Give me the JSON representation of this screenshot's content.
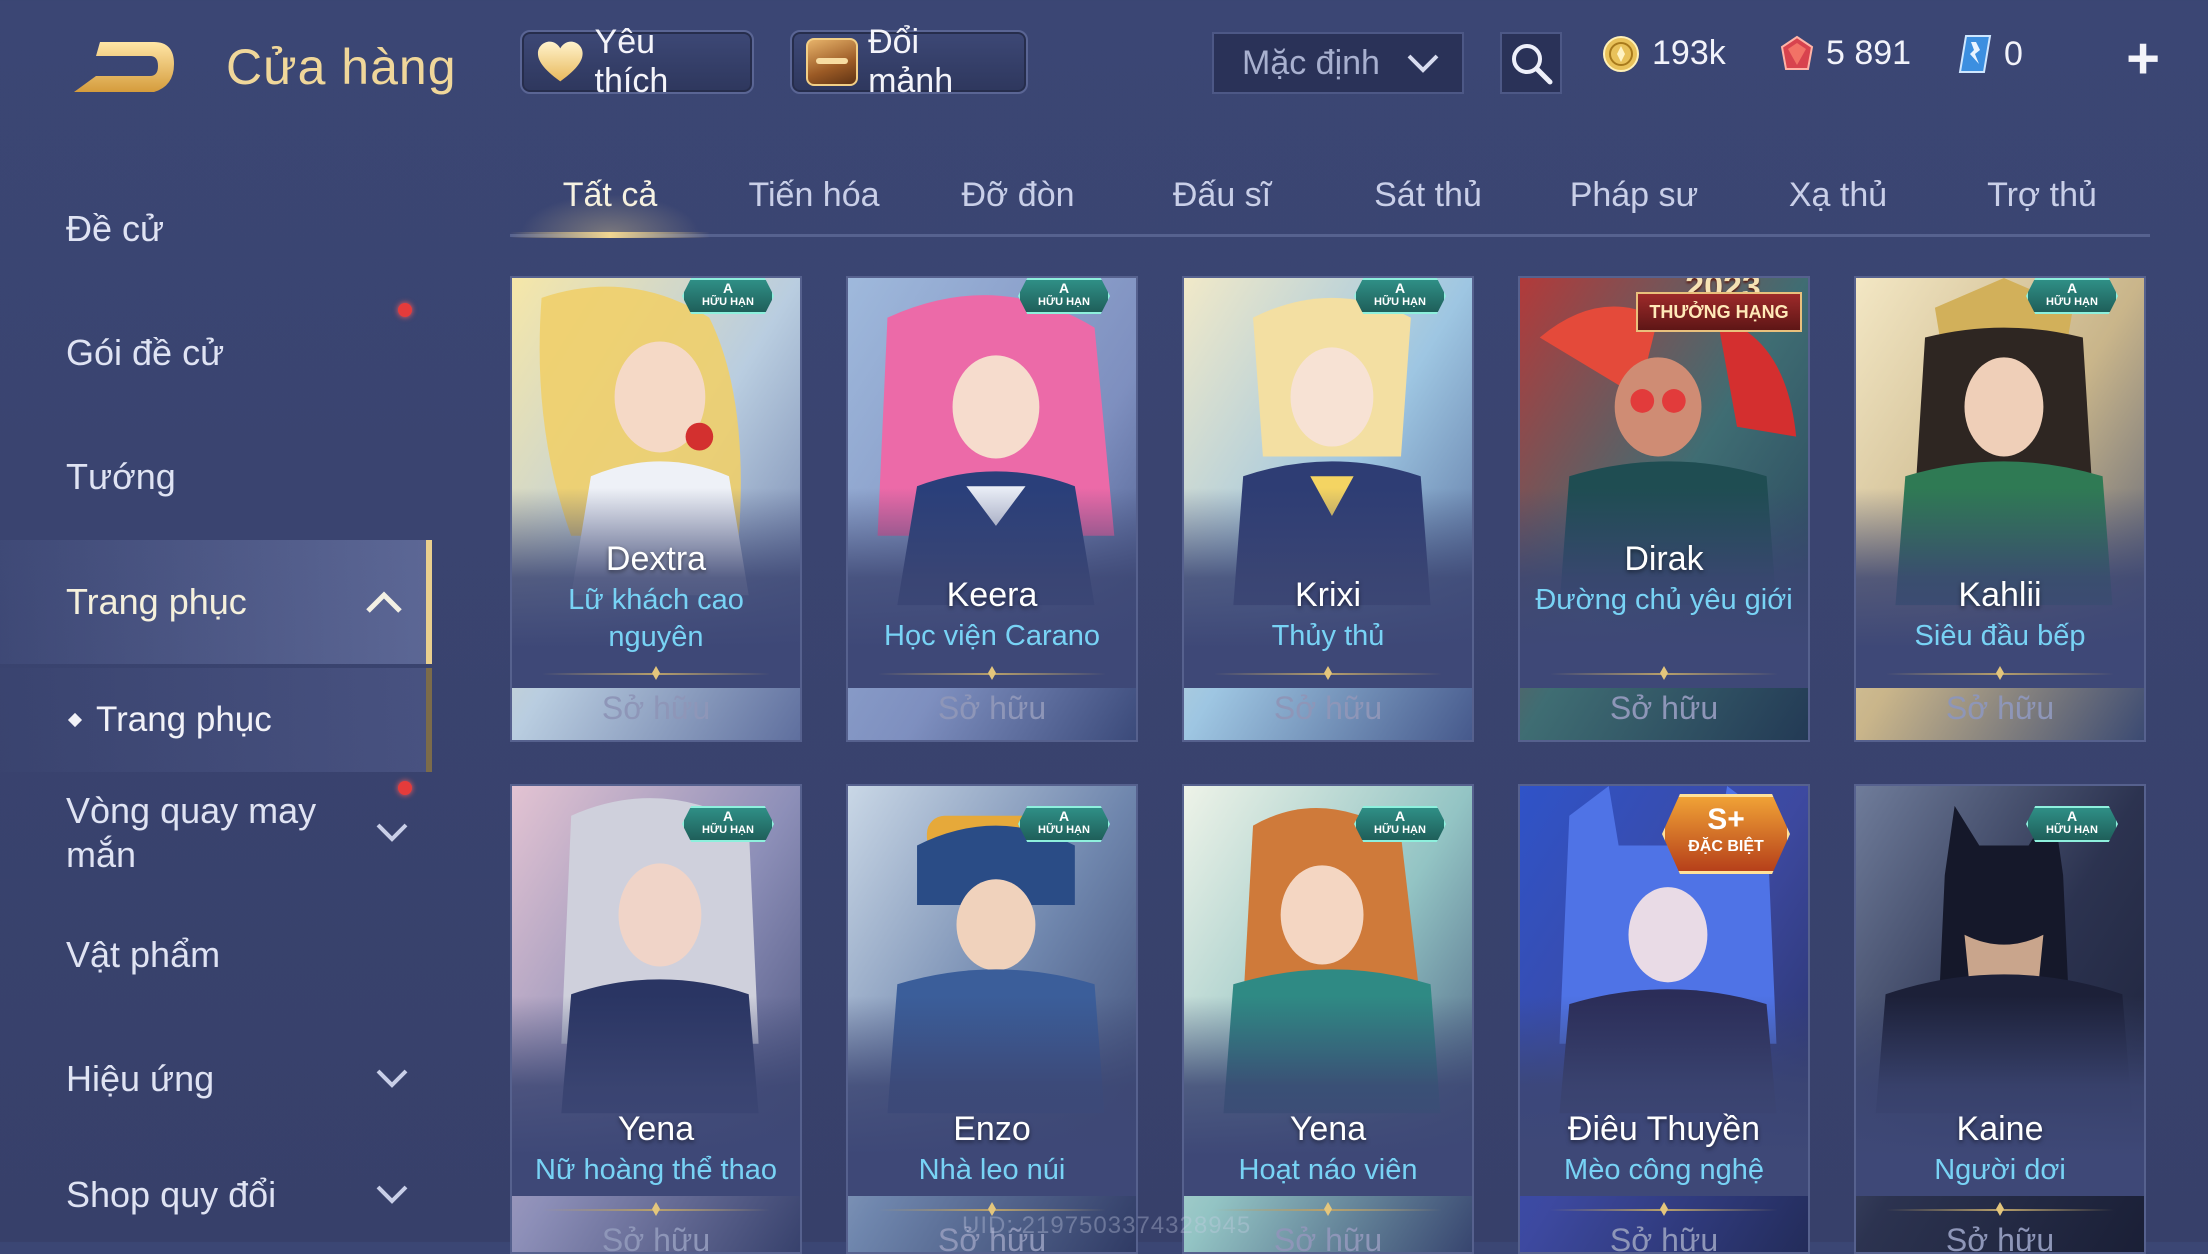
{
  "header": {
    "title": "Cửa hàng",
    "favorites_label": "Yêu thích",
    "exchange_label": "Đổi mảnh",
    "sort_value": "Mặc định",
    "currencies": {
      "gold": "193k",
      "ruby": "5 891",
      "voucher": "0"
    }
  },
  "sidebar": {
    "items": [
      {
        "label": "Đề cử"
      },
      {
        "label": "Gói đề cử"
      },
      {
        "label": "Tướng"
      },
      {
        "label": "Trang phục"
      },
      {
        "label": "Trang phục"
      },
      {
        "label": "Vòng quay may mắn"
      },
      {
        "label": "Vật phẩm"
      },
      {
        "label": "Hiệu ứng"
      },
      {
        "label": "Shop quy đổi"
      }
    ]
  },
  "tabs": [
    "Tất cả",
    "Tiến hóa",
    "Đỡ đòn",
    "Đấu sĩ",
    "Sát thủ",
    "Pháp sư",
    "Xạ thủ",
    "Trợ thủ"
  ],
  "badges": {
    "a_rank": "A",
    "a_text": "HỮU HẠN",
    "rank_text": "THƯỞNG HẠNG",
    "rank_year": "2023",
    "s_rank": "S+",
    "s_text": "ĐẶC BIỆT"
  },
  "skins": [
    {
      "hero": "Dextra",
      "skin": "Lữ khách cao nguyên",
      "status": "Sở hữu",
      "badge": "a"
    },
    {
      "hero": "Keera",
      "skin": "Học viện Carano",
      "status": "Sở hữu",
      "badge": "a"
    },
    {
      "hero": "Krixi",
      "skin": "Thủy thủ",
      "status": "Sở hữu",
      "badge": "a"
    },
    {
      "hero": "Dirak",
      "skin": "Đường chủ yêu giới",
      "status": "Sở hữu",
      "badge": "rank"
    },
    {
      "hero": "Kahlii",
      "skin": "Siêu đầu bếp",
      "status": "Sở hữu",
      "badge": "a"
    },
    {
      "hero": "Yena",
      "skin": "Nữ hoàng thể thao",
      "status": "Sở hữu",
      "badge": "a"
    },
    {
      "hero": "Enzo",
      "skin": "Nhà leo núi",
      "status": "Sở hữu",
      "badge": "a"
    },
    {
      "hero": "Yena",
      "skin": "Hoạt náo viên",
      "status": "Sở hữu",
      "badge": "a"
    },
    {
      "hero": "Điêu Thuyền",
      "skin": "Mèo công nghệ",
      "status": "Sở hữu",
      "badge": "s"
    },
    {
      "hero": "Kaine",
      "skin": "Người dơi",
      "status": "Sở hữu",
      "badge": "a"
    }
  ],
  "footer": {
    "uid": "UID: 2197503374328945"
  },
  "colors": {
    "accent_gold": "#f0d79a",
    "skin_name": "#78d3f5",
    "background": "#3b4674"
  }
}
